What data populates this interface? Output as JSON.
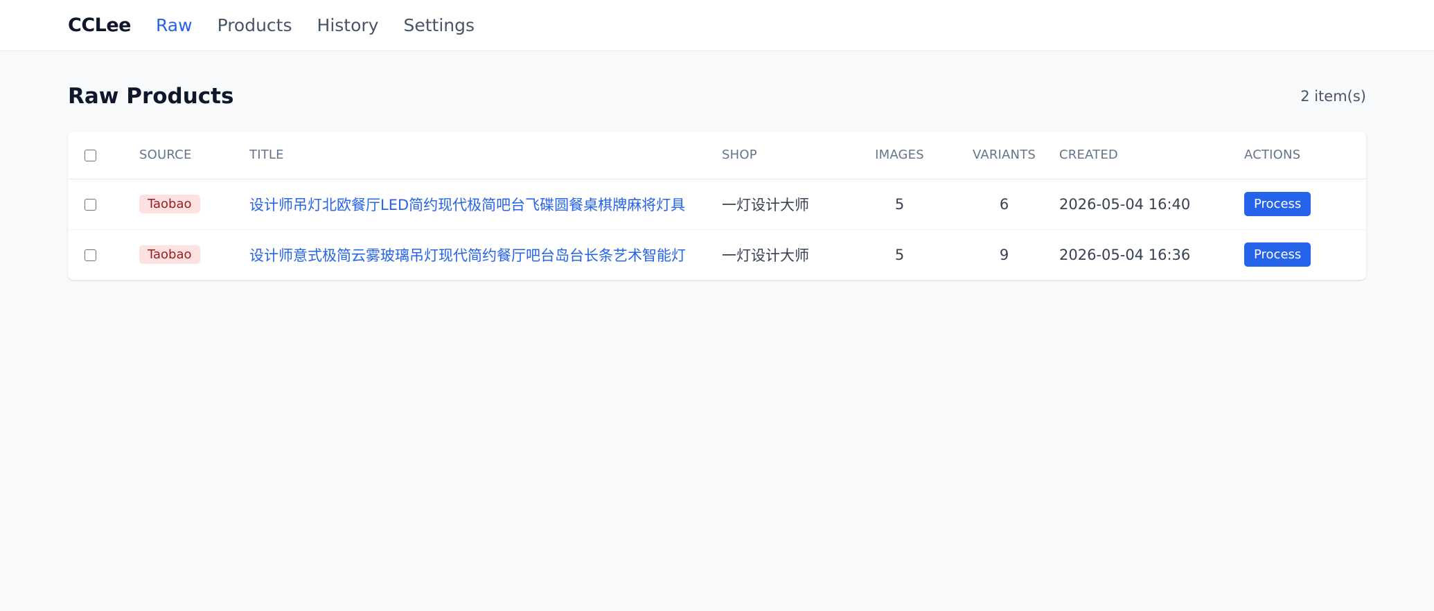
{
  "nav": {
    "brand": "CCLee",
    "links": [
      {
        "label": "Raw",
        "active": true
      },
      {
        "label": "Products",
        "active": false
      },
      {
        "label": "History",
        "active": false
      },
      {
        "label": "Settings",
        "active": false
      }
    ]
  },
  "page": {
    "title": "Raw Products",
    "count": "2 item(s)"
  },
  "table": {
    "headers": {
      "source": "SOURCE",
      "title": "TITLE",
      "shop": "SHOP",
      "images": "IMAGES",
      "variants": "VARIANTS",
      "created": "CREATED",
      "actions": "ACTIONS"
    },
    "rows": [
      {
        "source": "Taobao",
        "title": "设计师吊灯北欧餐厅LED简约现代极简吧台飞碟圆餐桌棋牌麻将灯具",
        "shop": "一灯设计大师",
        "images": "5",
        "variants": "6",
        "created": "2026-05-04 16:40",
        "action": "Process"
      },
      {
        "source": "Taobao",
        "title": "设计师意式极简云雾玻璃吊灯现代简约餐厅吧台岛台长条艺术智能灯",
        "shop": "一灯设计大师",
        "images": "5",
        "variants": "9",
        "created": "2026-05-04 16:36",
        "action": "Process"
      }
    ]
  },
  "colors": {
    "accent": "#2563eb",
    "badge_bg": "#fee2e2",
    "badge_text": "#991b1b",
    "background": "#f8fafc"
  }
}
